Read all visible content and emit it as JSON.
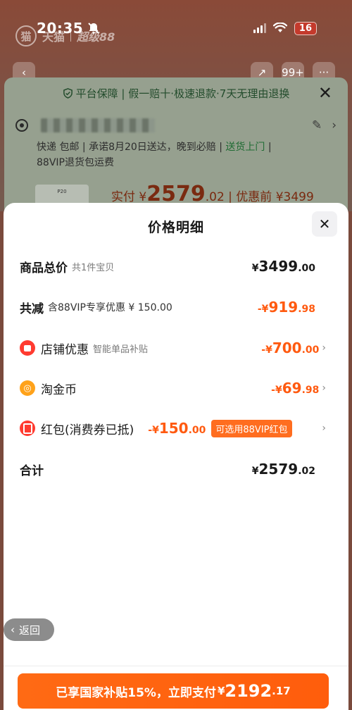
{
  "status_bar": {
    "time": "20:35",
    "battery": "16"
  },
  "app_header": {
    "logo": "猫",
    "brand": "天猫",
    "tag": "超级88"
  },
  "background_page": {
    "guarantee_text": "平台保障 | 假一赔十·极速退款·7天无理由退换",
    "delivery_line": "快递 包邮 | 承诺8月20日送达，晚到必赔 | ",
    "delivery_highlight": "送货上门",
    "delivery_suffix": " |",
    "return_line": "88VIP退货包运费",
    "product_thumb_label": "P20",
    "price_line_prefix": "实付 ¥",
    "price_big": "2579",
    "price_tail": ".02 | 优惠前 ¥3499"
  },
  "sheet": {
    "title": "价格明细",
    "rows": [
      {
        "label": "商品总价",
        "sub": "共1件宝贝",
        "cur": "¥",
        "int": "3499",
        "dec": ".00"
      },
      {
        "label": "共减",
        "sub": "含88VIP专享优惠 ¥ 150.00",
        "cur": "-¥",
        "int": "919",
        "dec": ".98"
      },
      {
        "label": "店铺优惠",
        "sub": "智能单品补贴",
        "cur": "-¥",
        "int": "700",
        "dec": ".00"
      },
      {
        "label": "淘金币",
        "sub": "",
        "cur": "-¥",
        "int": "69",
        "dec": ".98"
      },
      {
        "label": "红包(消费券已抵)",
        "cur": "-¥",
        "int": "150",
        "dec": ".00",
        "pill": "可选用88VIP红包"
      },
      {
        "label": "合计",
        "cur": "¥",
        "int": "2579",
        "dec": ".02"
      }
    ]
  },
  "back_button": {
    "label": "返回"
  },
  "pay_button": {
    "prefix": "已享国家补贴15%，立即支付",
    "cur": "¥",
    "int": "2192",
    "dec": ".17"
  },
  "icons": {
    "bell": "bell-slash-icon",
    "location": "location-icon",
    "shield": "shield-icon",
    "close": "close-icon",
    "shop": "shop-icon",
    "coin": "coin-icon",
    "redpacket": "red-packet-icon"
  },
  "colors": {
    "accent": "#ff5a10",
    "pay_button": "#ff6a14",
    "pill": "#ff6d1f",
    "text": "#1a1a1a"
  }
}
